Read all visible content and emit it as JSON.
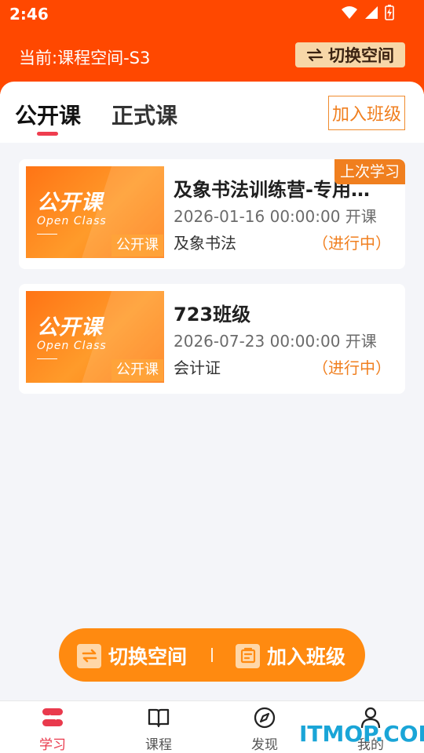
{
  "status_bar": {
    "time": "2:46",
    "icons": [
      "wifi-icon",
      "cellular-signal-icon",
      "battery-charging-icon"
    ]
  },
  "header": {
    "current_space": "当前:课程空间-S3",
    "switch_space_label": "切换空间",
    "background_color": "#ff4800"
  },
  "tabs": {
    "items": [
      {
        "label": "公开课",
        "active": true
      },
      {
        "label": "正式课",
        "active": false
      }
    ],
    "join_class_label": "加入班级"
  },
  "courses": [
    {
      "thumbnail": {
        "title": "公开课",
        "subtitle": "Open Class",
        "badge": "公开课"
      },
      "title": "及象书法训练营-专用…",
      "date": "2026-01-16 00:00:00 开课",
      "organization": "及象书法",
      "status": "（进行中）",
      "last_study_badge": "上次学习"
    },
    {
      "thumbnail": {
        "title": "公开课",
        "subtitle": "Open Class",
        "badge": "公开课"
      },
      "title": "723班级",
      "date": "2026-07-23 00:00:00 开课",
      "organization": "会计证",
      "status": "（进行中）"
    }
  ],
  "floating_bar": {
    "switch_label": "切换空间",
    "join_label": "加入班级",
    "color": "#ff8a10"
  },
  "bottom_nav": {
    "items": [
      {
        "label": "学习",
        "icon": "stack-icon",
        "active": true
      },
      {
        "label": "课程",
        "icon": "book-icon",
        "active": false
      },
      {
        "label": "发现",
        "icon": "compass-icon",
        "active": false
      },
      {
        "label": "我的",
        "icon": "person-icon",
        "active": false
      }
    ]
  },
  "watermark": "ITMOP.COM",
  "colors": {
    "accent_orange": "#f07f1f",
    "active_red": "#e93a4d"
  }
}
